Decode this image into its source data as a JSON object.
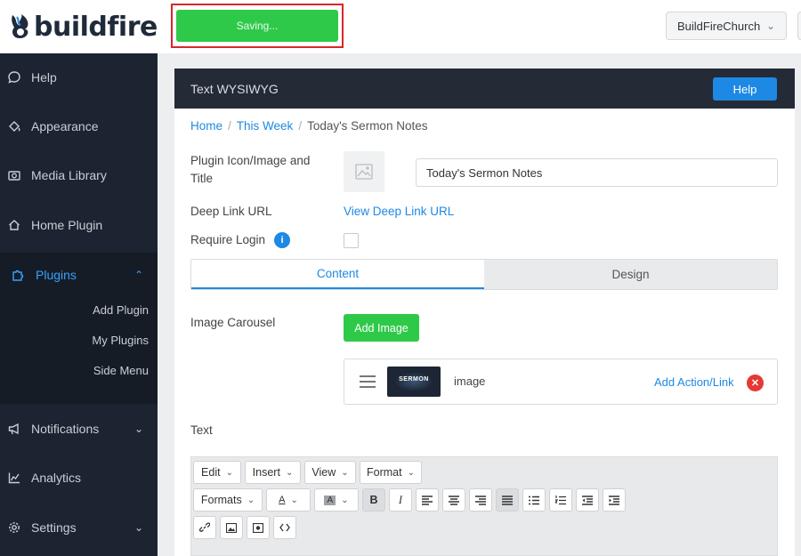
{
  "brand": {
    "name": "buildfire"
  },
  "topbar": {
    "saving_label": "Saving...",
    "account_name": "BuildFireChurch"
  },
  "sidebar": {
    "items": [
      {
        "label": "Help",
        "icon": "chat-bubble-icon"
      },
      {
        "label": "Appearance",
        "icon": "paint-bucket-icon"
      },
      {
        "label": "Media Library",
        "icon": "camera-icon"
      },
      {
        "label": "Home Plugin",
        "icon": "house-icon"
      },
      {
        "label": "Plugins",
        "icon": "puzzle-icon",
        "expanded": true
      },
      {
        "label": "Notifications",
        "icon": "megaphone-icon"
      },
      {
        "label": "Analytics",
        "icon": "line-chart-icon"
      },
      {
        "label": "Settings",
        "icon": "gear-icon"
      }
    ],
    "plugin_subitems": [
      "Add Plugin",
      "My Plugins",
      "Side Menu"
    ]
  },
  "panel": {
    "title": "Text WYSIWYG",
    "help_label": "Help",
    "breadcrumb": [
      "Home",
      "This Week",
      "Today's Sermon Notes"
    ],
    "icon_title_label": "Plugin Icon/Image and Title",
    "title_value": "Today's Sermon Notes",
    "deep_link_label": "Deep Link URL",
    "deep_link_link": "View Deep Link URL",
    "require_login_label": "Require Login",
    "require_login_checked": false,
    "tabs": [
      {
        "label": "Content",
        "active": true
      },
      {
        "label": "Design",
        "active": false
      }
    ],
    "carousel_label": "Image Carousel",
    "add_image_label": "Add Image",
    "carousel_items": [
      {
        "thumb_text": "SERMON",
        "name": "image",
        "action_label": "Add Action/Link"
      }
    ],
    "text_label": "Text"
  },
  "editor": {
    "menus": [
      "Edit",
      "Insert",
      "View",
      "Format"
    ],
    "formats_label": "Formats",
    "text_color_glyph": "A",
    "bg_color_glyph": "A",
    "bold_glyph": "B",
    "italic_glyph": "I"
  },
  "colors": {
    "accent": "#1e88e5",
    "success": "#2fc94a",
    "danger": "#e53935",
    "sidebar": "#1b2430",
    "header": "#242b36"
  }
}
